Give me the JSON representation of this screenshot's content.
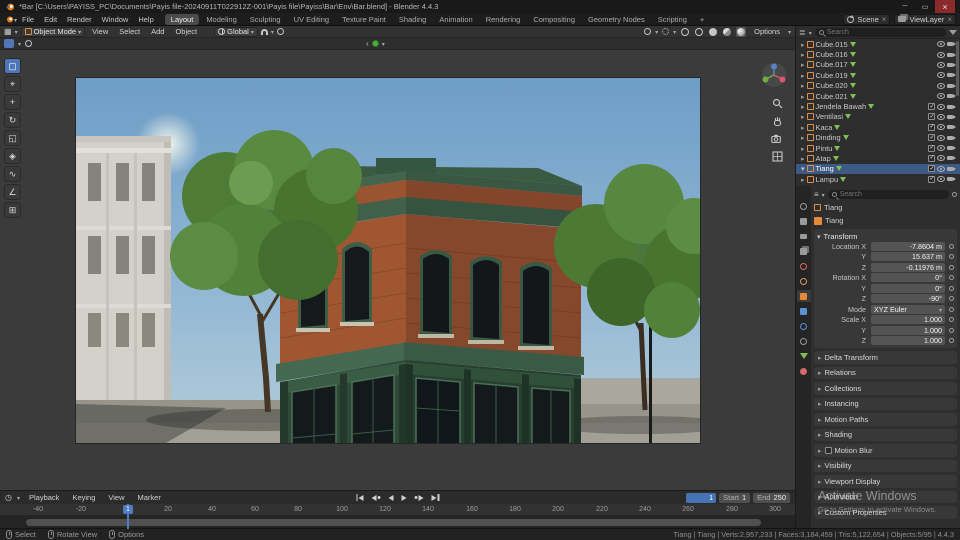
{
  "window": {
    "title": "*Bar [C:\\Users\\PAYISS_PC\\Documents\\Payis file-20240911T022912Z-001\\Payis file\\Payiss\\Bar\\Env\\Bar.blend] - Blender 4.4.3"
  },
  "menubar": {
    "menus": [
      "File",
      "Edit",
      "Render",
      "Window",
      "Help"
    ],
    "workspaces": [
      "Layout",
      "Modeling",
      "Sculpting",
      "UV Editing",
      "Texture Paint",
      "Shading",
      "Animation",
      "Rendering",
      "Compositing",
      "Geometry Nodes",
      "Scripting"
    ],
    "add_workspace": "+",
    "scene_name": "Scene",
    "viewlayer_name": "ViewLayer"
  },
  "viewport_header": {
    "mode": "Object Mode",
    "menus": [
      "View",
      "Select",
      "Add",
      "Object"
    ],
    "orientation": "Global",
    "options_label": "Options"
  },
  "outliner": {
    "search_placeholder": "Search",
    "items": [
      "Cube.015",
      "Cube.016",
      "Cube.017",
      "Cube.019",
      "Cube.020",
      "Cube.021",
      "Jendela Bawah",
      "Ventilasi",
      "Kaca",
      "Dinding",
      "Pintu",
      "Atap",
      "Tiang",
      "Lampu"
    ]
  },
  "properties": {
    "search_placeholder": "Search",
    "breadcrumb_object": "Tiang",
    "object_name": "Tiang",
    "transform": {
      "title": "Transform",
      "rows": [
        {
          "label": "Location X",
          "value": "-7.8604 m"
        },
        {
          "label": "Y",
          "value": "15.637 m"
        },
        {
          "label": "Z",
          "value": "-0.11976 m"
        },
        {
          "label": "Rotation X",
          "value": "0°"
        },
        {
          "label": "Y",
          "value": "0°"
        },
        {
          "label": "Z",
          "value": "-90°"
        },
        {
          "label": "Mode",
          "value": "XYZ Euler"
        },
        {
          "label": "Scale X",
          "value": "1.000"
        },
        {
          "label": "Y",
          "value": "1.000"
        },
        {
          "label": "Z",
          "value": "1.000"
        }
      ]
    },
    "panels": [
      "Delta Transform",
      "Relations",
      "Collections",
      "Instancing",
      "Motion Paths",
      "Shading",
      "Motion Blur",
      "Visibility",
      "Viewport Display",
      "Animation",
      "Custom Properties"
    ]
  },
  "timeline": {
    "menus": [
      "Playback",
      "Keying",
      "View",
      "Marker"
    ],
    "current_frame": "1",
    "frame_badge": "1",
    "start_label": "Start",
    "start_value": "1",
    "end_label": "End",
    "end_value": "250",
    "ruler": [
      "-40",
      "-20",
      "0",
      "20",
      "40",
      "60",
      "80",
      "100",
      "120",
      "140",
      "160",
      "180",
      "200",
      "220",
      "240",
      "260",
      "280",
      "300"
    ]
  },
  "statusbar": {
    "hints": [
      "Select",
      "Rotate View",
      "Options"
    ],
    "info": "Tiang | Tiang | Verts:2,957,233 | Faces:3,184,459 | Tris:5,122,654 | Objects:5/95 | 4.4.3"
  },
  "watermark": {
    "line1": "Activate Windows",
    "line2": "Go to Settings to activate Windows."
  },
  "icons": {
    "chevron_down": "▾",
    "chevron_right": "▸",
    "search": "magnifier",
    "eye": "eye-outline",
    "camera": "camera-body",
    "checkbox_check": "✓",
    "clock": "◷",
    "grid_editor": "▦",
    "accent_blue": "#4772b3",
    "selection_row": "#3d5a85",
    "object_orange": "#e58a3a"
  }
}
